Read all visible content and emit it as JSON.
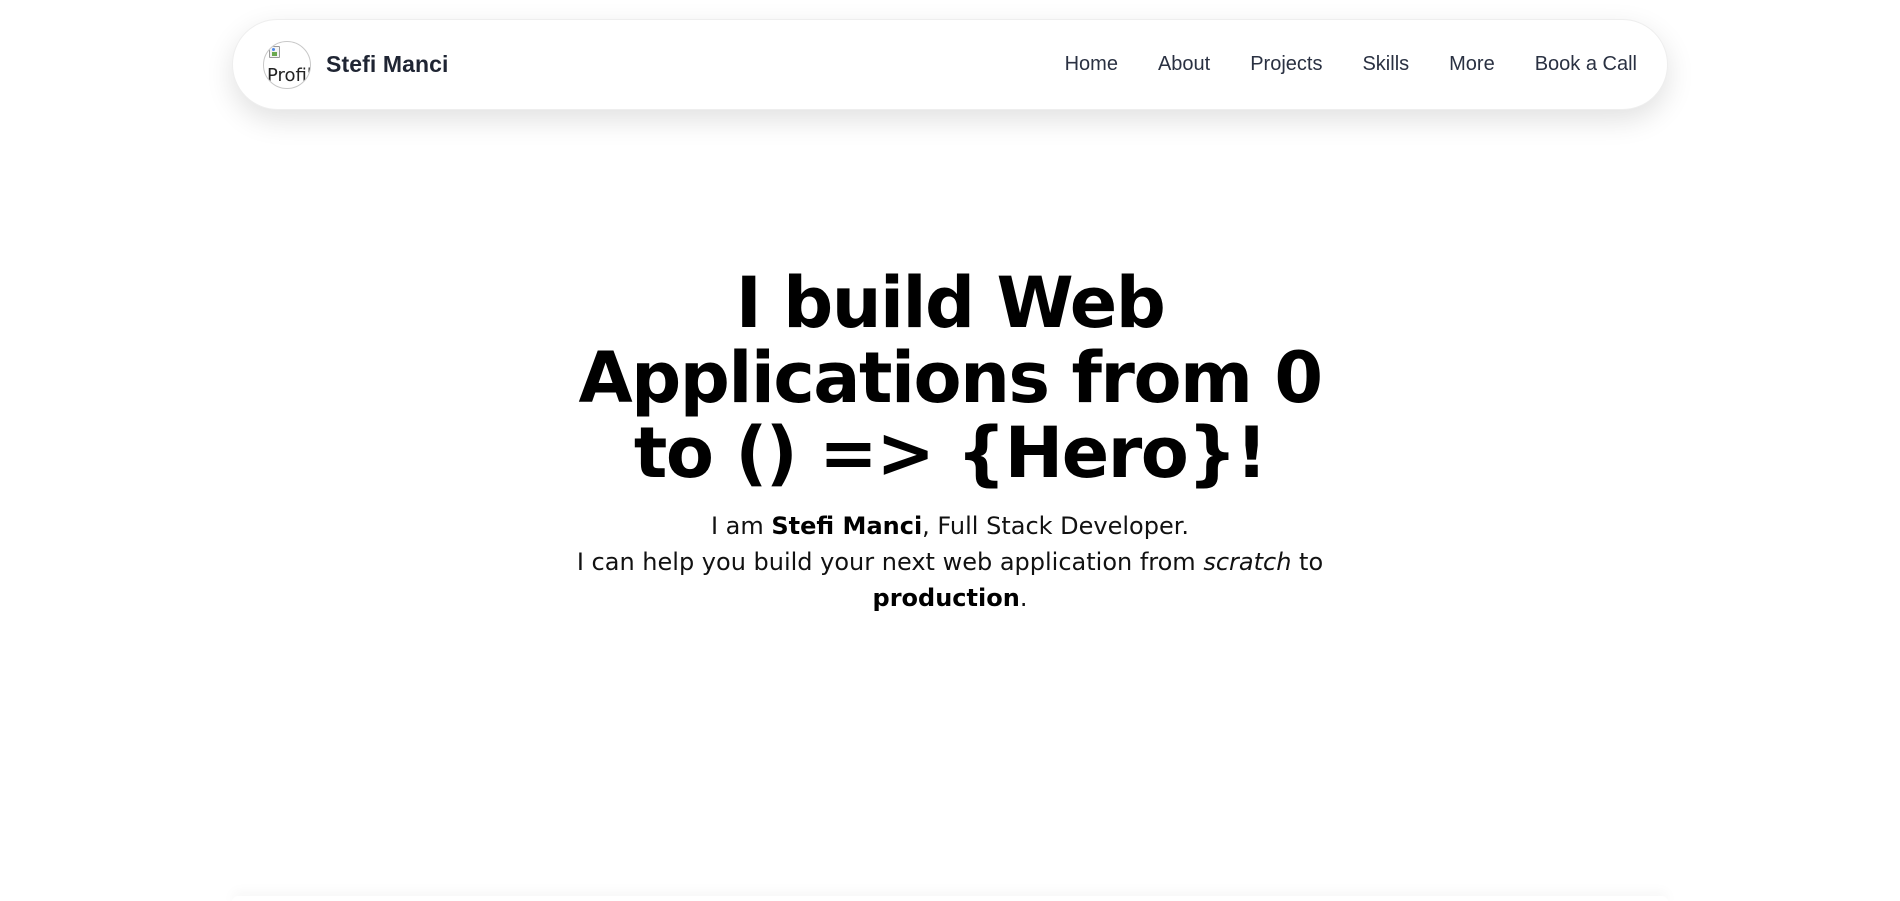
{
  "navbar": {
    "avatar_alt": "Profil",
    "brand_name": "Stefi Manci",
    "links": [
      {
        "label": "Home"
      },
      {
        "label": "About"
      },
      {
        "label": "Projects"
      },
      {
        "label": "Skills"
      },
      {
        "label": "More"
      },
      {
        "label": "Book a Call"
      }
    ]
  },
  "hero": {
    "title_lines": [
      "I build Web",
      "Applications from 0",
      "to () => {Hero}!"
    ],
    "intro_prefix": "I am ",
    "intro_name": "Stefi Manci",
    "intro_suffix": ", Full Stack Developer.",
    "help_prefix": "I can help you build your next web application from ",
    "help_em": "scratch",
    "help_mid": " to ",
    "help_strong": "production",
    "help_end": "."
  },
  "colors": {
    "background": "#ffffff",
    "nav_text": "#2a3142",
    "brand_text": "#1f2533",
    "hero_text": "#000000"
  }
}
